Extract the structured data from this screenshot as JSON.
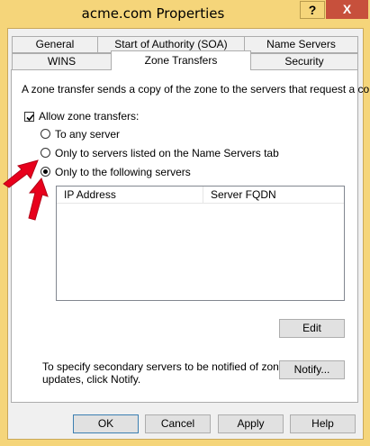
{
  "window": {
    "title": "acme.com Properties",
    "help_label": "?",
    "close_label": "X"
  },
  "tabs": {
    "row1": [
      "General",
      "Start of Authority (SOA)",
      "Name Servers"
    ],
    "row2": [
      "WINS",
      "Zone Transfers",
      "Security"
    ],
    "active": "Zone Transfers"
  },
  "zone_transfers": {
    "description": "A zone transfer sends a copy of the zone to the servers that request a copy.",
    "allow_label": "Allow zone transfers:",
    "allow_checked": true,
    "options": [
      {
        "label": "To any server",
        "selected": false
      },
      {
        "label": "Only to servers listed on the Name Servers tab",
        "selected": false
      },
      {
        "label": "Only to the following servers",
        "selected": true
      }
    ],
    "columns": [
      "IP Address",
      "Server FQDN"
    ],
    "edit_label": "Edit",
    "notify_text_line1": "To specify secondary servers to be notified of zone",
    "notify_text_line2": "updates, click Notify.",
    "notify_label": "Notify..."
  },
  "footer": {
    "ok": "OK",
    "cancel": "Cancel",
    "apply": "Apply",
    "help": "Help"
  },
  "colors": {
    "frame": "#f5d57a",
    "close": "#c7503c",
    "arrow": "#e8001c",
    "default_border": "#3c7fb1"
  }
}
